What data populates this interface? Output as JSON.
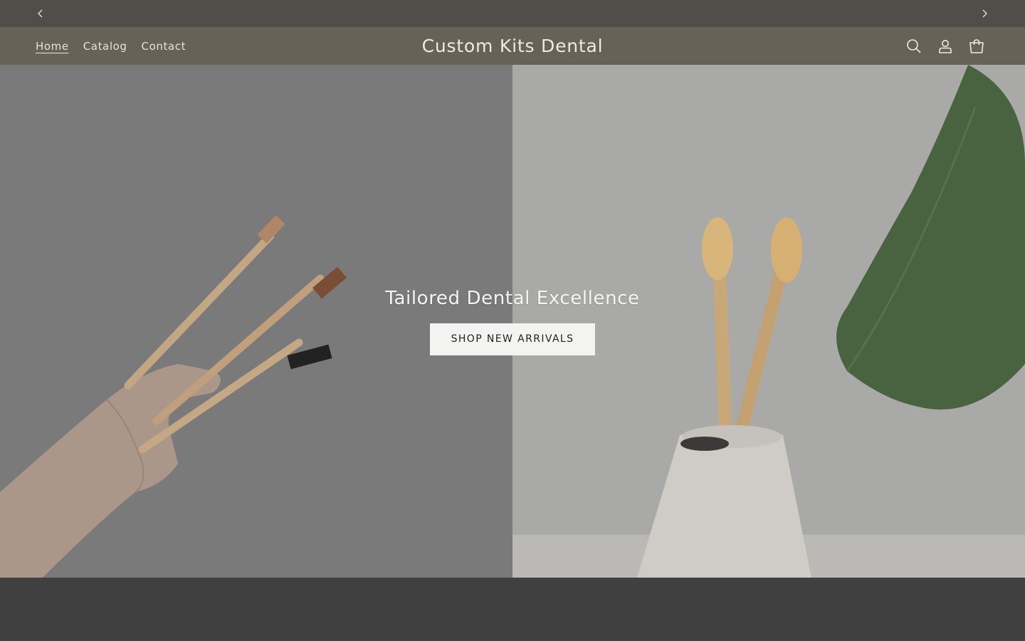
{
  "announcement": {
    "prev_icon": "chevron-left-icon",
    "next_icon": "chevron-right-icon"
  },
  "header": {
    "nav": [
      {
        "label": "Home",
        "active": true
      },
      {
        "label": "Catalog",
        "active": false
      },
      {
        "label": "Contact",
        "active": false
      }
    ],
    "logo": "Custom Kits Dental",
    "icons": [
      "search-icon",
      "account-icon",
      "cart-icon"
    ]
  },
  "hero": {
    "title": "Tailored Dental Excellence",
    "button_label": "SHOP NEW ARRIVALS",
    "left_image": "hand-holding-three-bamboo-toothbrushes",
    "right_image": "two-bamboo-toothbrushes-in-white-holder-with-plant"
  },
  "colors": {
    "announcement_bg": "#514e49",
    "header_bg": "#666257",
    "header_text": "#e6e2d8",
    "button_bg": "#f3f3f1",
    "footer_band": "#404040"
  }
}
